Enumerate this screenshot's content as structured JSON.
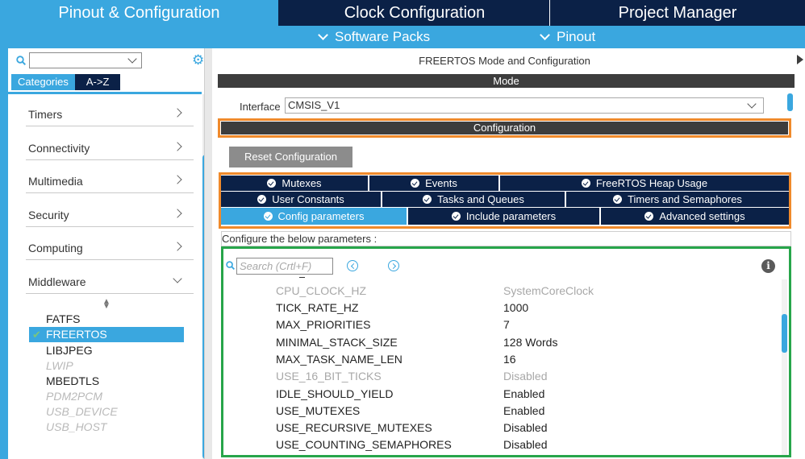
{
  "top_tabs": {
    "pinout": "Pinout & Configuration",
    "clock": "Clock Configuration",
    "project": "Project Manager"
  },
  "sub_menu": {
    "software_packs": "Software Packs",
    "pinout": "Pinout"
  },
  "sidebar": {
    "search_value": "",
    "tabs": {
      "categories": "Categories",
      "az": "A->Z"
    },
    "categories": [
      {
        "label": "Timers",
        "expanded": false
      },
      {
        "label": "Connectivity",
        "expanded": false
      },
      {
        "label": "Multimedia",
        "expanded": false
      },
      {
        "label": "Security",
        "expanded": false
      },
      {
        "label": "Computing",
        "expanded": false
      },
      {
        "label": "Middleware",
        "expanded": true
      }
    ],
    "middleware_items": [
      {
        "label": "FATFS",
        "state": "enabled"
      },
      {
        "label": "FREERTOS",
        "state": "selected"
      },
      {
        "label": "LIBJPEG",
        "state": "enabled"
      },
      {
        "label": "LWIP",
        "state": "disabled"
      },
      {
        "label": "MBEDTLS",
        "state": "enabled"
      },
      {
        "label": "PDM2PCM",
        "state": "disabled"
      },
      {
        "label": "USB_DEVICE",
        "state": "disabled"
      },
      {
        "label": "USB_HOST",
        "state": "disabled"
      }
    ]
  },
  "main": {
    "title": "FREERTOS Mode and Configuration",
    "mode_header": "Mode",
    "interface_label": "Interface",
    "interface_value": "CMSIS_V1",
    "configuration_header": "Configuration",
    "reset_button": "Reset Configuration",
    "config_tabs": [
      [
        "Mutexes",
        "Events",
        "FreeRTOS Heap Usage"
      ],
      [
        "User Constants",
        "Tasks and Queues",
        "Timers and Semaphores"
      ],
      [
        "Config parameters",
        "Include parameters",
        "Advanced settings"
      ]
    ],
    "selected_tab": "Config parameters",
    "hint": "Configure the below parameters :",
    "search_placeholder": "Search (Crtl+F)",
    "parameters": [
      {
        "name": "CPU_CLOCK_HZ",
        "value": "SystemCoreClock",
        "editable": false
      },
      {
        "name": "TICK_RATE_HZ",
        "value": "1000",
        "editable": true
      },
      {
        "name": "MAX_PRIORITIES",
        "value": "7",
        "editable": true
      },
      {
        "name": "MINIMAL_STACK_SIZE",
        "value": "128 Words",
        "editable": true
      },
      {
        "name": "MAX_TASK_NAME_LEN",
        "value": "16",
        "editable": true
      },
      {
        "name": "USE_16_BIT_TICKS",
        "value": "Disabled",
        "editable": false
      },
      {
        "name": "IDLE_SHOULD_YIELD",
        "value": "Enabled",
        "editable": true
      },
      {
        "name": "USE_MUTEXES",
        "value": "Enabled",
        "editable": true
      },
      {
        "name": "USE_RECURSIVE_MUTEXES",
        "value": "Disabled",
        "editable": true
      },
      {
        "name": "USE_COUNTING_SEMAPHORES",
        "value": "Disabled",
        "editable": true
      }
    ]
  },
  "colors": {
    "accent_blue": "#3aa7df",
    "navy": "#0b2147",
    "highlight_orange": "#f08a2b",
    "highlight_green": "#27a54a"
  }
}
